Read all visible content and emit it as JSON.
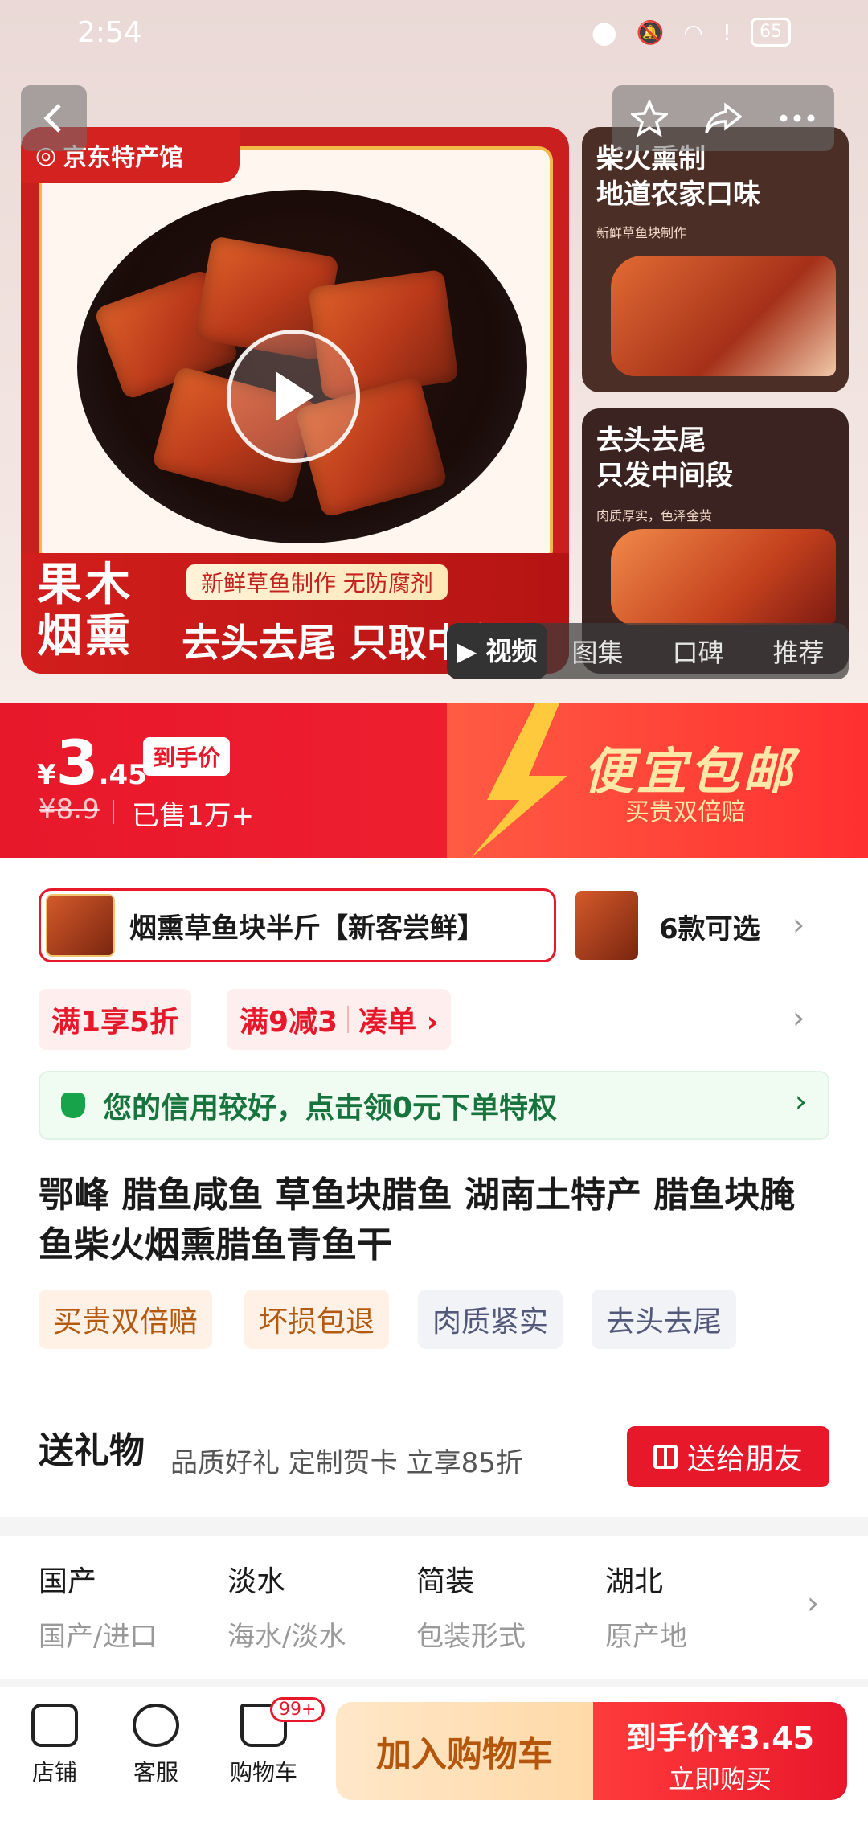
{
  "status_bar": {
    "time": "2:54",
    "battery": "65"
  },
  "gallery": {
    "brand": "京东特产馆",
    "main_badge": "果木\n烟熏",
    "main_sub": "新鲜草鱼制作 无防腐剂",
    "main_slogan": "去头去尾 只取中段",
    "side1_title": "柴火熏制\n地道农家口味",
    "side1_sub": "新鲜草鱼块制作",
    "side2_title": "去头去尾\n只发中间段",
    "side2_sub": "肉质厚实，色泽金黄",
    "tabs": [
      {
        "label": "▶ 视频",
        "active": true
      },
      {
        "label": "图集",
        "active": false
      },
      {
        "label": "口碑",
        "active": false
      },
      {
        "label": "推荐",
        "active": false
      }
    ]
  },
  "price": {
    "currency": "¥",
    "integer": "3",
    "decimal": ".45",
    "tag": "到手价",
    "original": "¥8.9",
    "sold": "已售1万+",
    "promo_title": "便宜包邮",
    "promo_sub": "买贵双倍赔"
  },
  "sku": {
    "selected": "烟熏草鱼块半斤【新客尝鲜】",
    "count": "6款可选"
  },
  "coupons": {
    "c1": "满1享5折",
    "c2a": "满9减3",
    "c2b": "凑单 ›"
  },
  "credit": {
    "text": "您的信用较好，点击领0元下单特权"
  },
  "product_title": "鄂峰 腊鱼咸鱼 草鱼块腊鱼 湖南土特产 腊鱼块腌鱼柴火烟熏腊鱼青鱼干",
  "tags": [
    "买贵双倍赔",
    "坏损包退",
    "肉质紧实",
    "去头去尾"
  ],
  "gift": {
    "title": "送礼物",
    "sub": "品质好礼 定制贺卡 立享85折",
    "button": "送给朋友"
  },
  "attributes": [
    {
      "value": "国产",
      "key": "国产/进口"
    },
    {
      "value": "淡水",
      "key": "海水/淡水"
    },
    {
      "value": "简装",
      "key": "包装形式"
    },
    {
      "value": "湖北",
      "key": "原产地"
    }
  ],
  "bottom": {
    "shop": "店铺",
    "service": "客服",
    "cart": "购物车",
    "cart_badge": "99+",
    "add_cart": "加入购物车",
    "buy_price": "到手价¥3.45",
    "buy": "立即购买"
  }
}
